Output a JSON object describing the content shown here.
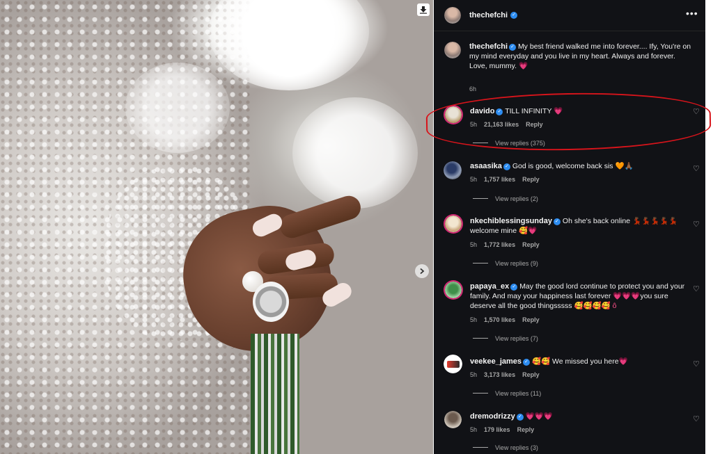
{
  "header": {
    "username": "thechefchi",
    "more_label": "•••"
  },
  "caption": {
    "username": "thechefchi",
    "text": "My best friend walked me into forever.... Ify, You're on my mind everyday and you live in my heart. Always and forever.",
    "line3": "Love, mummy.",
    "emoji": "💗",
    "time": "6h"
  },
  "comments": [
    {
      "username": "davido",
      "text": "TILL INFINITY",
      "emoji": "💗",
      "time": "5h",
      "likes": "21,163 likes",
      "reply": "Reply",
      "view_replies": "View replies (375)"
    },
    {
      "username": "asaasika",
      "text": "God is good, welcome back sis",
      "emoji": "🧡🙏🏾",
      "time": "5h",
      "likes": "1,757 likes",
      "reply": "Reply",
      "view_replies": "View replies (2)"
    },
    {
      "username": "nkechiblessingsunday",
      "text": "Oh she's back online 💃🏾💃🏾💃🏾💃🏾💃🏾 welcome mine",
      "emoji": "🥰💗",
      "time": "5h",
      "likes": "1,772 likes",
      "reply": "Reply",
      "view_replies": "View replies (9)"
    },
    {
      "username": "papaya_ex",
      "text": "May the good lord continue to protect you and your family. And may your happiness last forever 💗💗💗you sure deserve all the good thingsssss",
      "emoji": "🥰🥰🥰🥰 ô",
      "time": "5h",
      "likes": "1,570 likes",
      "reply": "Reply",
      "view_replies": "View replies (7)"
    },
    {
      "username": "veekee_james",
      "text": "We missed you here",
      "emoji": "🥰🥰",
      "emoji_after": "💗",
      "time": "5h",
      "likes": "3,173 likes",
      "reply": "Reply",
      "view_replies": "View replies (11)"
    },
    {
      "username": "dremodrizzy",
      "text": "",
      "emoji": "💗💗💗",
      "time": "5h",
      "likes": "179 likes",
      "reply": "Reply",
      "view_replies": "View replies (3)"
    }
  ],
  "colors": {
    "panel_bg": "#111216",
    "verified": "#2d8cf0",
    "highlight": "#d8141b",
    "muted": "#a8a8a8"
  },
  "icons": {
    "download": "download-icon",
    "next": "chevron-right-icon",
    "like": "heart-outline-icon",
    "verified": "verified-badge-icon"
  }
}
